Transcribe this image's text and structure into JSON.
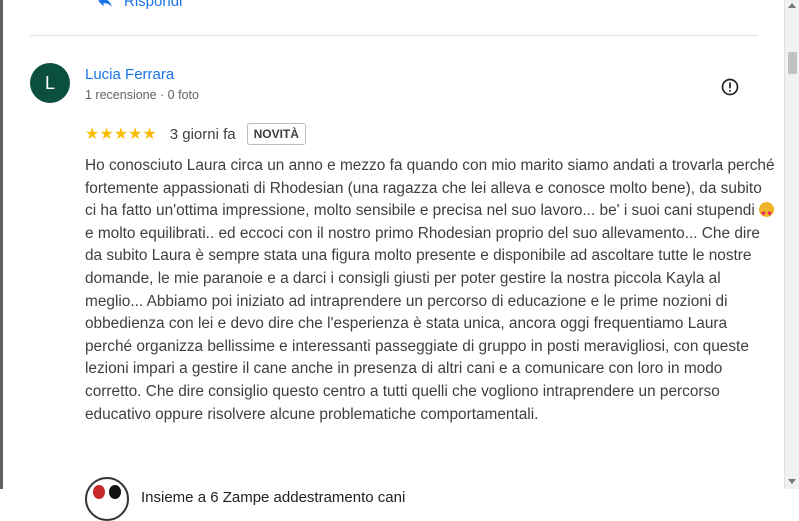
{
  "previous_review": {
    "reply_label": "Rispondi"
  },
  "review": {
    "avatar_initial": "L",
    "author": "Lucia Ferrara",
    "meta": "1 recensione · 0 foto",
    "stars": "★★★★★",
    "time": "3 giorni fa",
    "badge": "NOVITÀ",
    "text_part1": "Ho conosciuto Laura circa un anno e mezzo fa quando con mio marito siamo andati a trovarla perché fortemente appassionati di Rhodesian (una ragazza che lei alleva e conosce molto bene), da subito ci ha fatto un'ottima impressione, molto sensibile e precisa nel suo lavoro... be' i suoi cani stupendi",
    "text_part2": "e molto equilibrati.. ed eccoci con il nostro primo Rhodesian proprio del suo allevamento... Che dire da subito Laura è sempre stata una figura molto presente e disponibile ad ascoltare tutte le nostre domande, le mie paranoie e a darci i consigli giusti per poter gestire la nostra piccola Kayla al meglio... Abbiamo poi iniziato ad intraprendere un percorso di educazione e le prime nozioni di obbedienza con lei e devo dire che l'esperienza è stata unica, ancora oggi frequentiamo Laura perché organizza bellissime e interessanti passeggiate di gruppo in posti meravigliosi, con queste lezioni impari a gestire il cane anche in presenza di altri cani e a comunicare con loro in modo corretto. Che dire consiglio questo centro a tutti quelli che vogliono intraprendere un percorso educativo oppure risolvere alcune problematiche comportamentali.",
    "emoji_icon": "smiling-face-with-heart-eyes-icon"
  },
  "owner_response": {
    "name": "Insieme a 6 Zampe addestramento cani"
  },
  "colors": {
    "link": "#1a73e8",
    "star": "#fbbc04",
    "avatar": "#0b4f3f"
  }
}
